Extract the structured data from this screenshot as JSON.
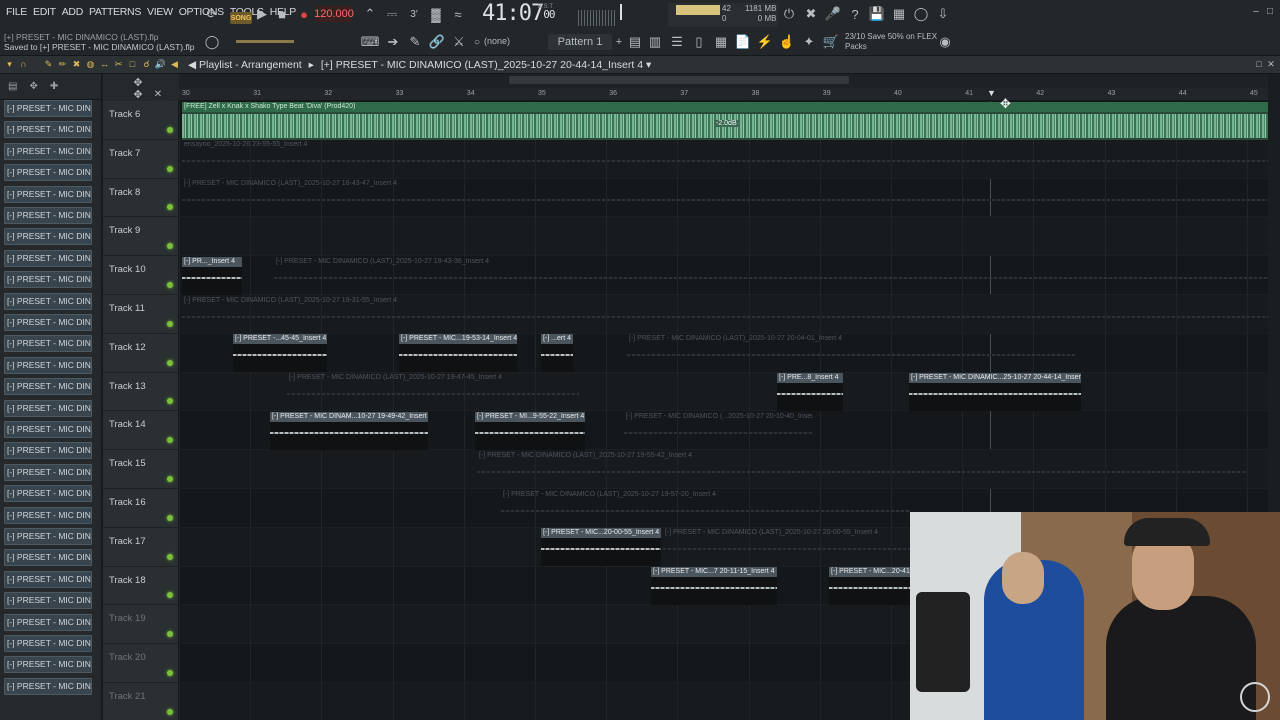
{
  "menu": [
    "FILE",
    "EDIT",
    "ADD",
    "PATTERNS",
    "VIEW",
    "OPTIONS",
    "TOOLS",
    "HELP"
  ],
  "file_status": {
    "project": "[+] PRESET - MIC DINAMICO (LAST).flp",
    "saved": "Saved to [+] PRESET - MIC DINAMICO (LAST).flp"
  },
  "transport": {
    "mode": "SONG",
    "tempo": "120.000",
    "time": "41:07",
    "time_sub": "00",
    "time_label": "B:S:T"
  },
  "meters": {
    "cpu": "42",
    "cpu_unit": "0",
    "mem": "1181 MB",
    "mem_sub": "0 MB"
  },
  "pattern": {
    "selector": "Pattern 1",
    "none": "(none)"
  },
  "promo": {
    "line1": "23/10",
    "line2": "Save 50% on FLEX",
    "line3": "Packs"
  },
  "playlist": {
    "title": "Playlist - Arrangement",
    "breadcrumb": "[+] PRESET - MIC DINAMICO (LAST)_2025-10-27 20-44-14_Insert 4"
  },
  "ruler_ticks": [
    "30",
    "31",
    "32",
    "33",
    "34",
    "35",
    "36",
    "37",
    "38",
    "39",
    "40",
    "41",
    "42",
    "43",
    "44",
    "45"
  ],
  "patterns": [
    "[-] PRESET - MIC DINAMIC..",
    "[-] PRESET - MIC DINAMIC..",
    "[-] PRESET - MIC DINAMIC..",
    "[-] PRESET - MIC DINAMIC..",
    "[-] PRESET - MIC DINAMIC..",
    "[-] PRESET - MIC DINAMIC..",
    "[-] PRESET - MIC DINAMIC..",
    "[-] PRESET - MIC DINAMIC..",
    "[-] PRESET - MIC DINAMIC..",
    "[-] PRESET - MIC DINAMIC..",
    "[-] PRESET - MIC DINAMIC..",
    "[-] PRESET - MIC DINAMIC..",
    "[-] PRESET - MIC DINAMIC..",
    "[-] PRESET - MIC DINAMIC..",
    "[-] PRESET - MIC DINAMIC..",
    "[-] PRESET - MIC DINAMIC..",
    "[-] PRESET - MIC DINAMIC..",
    "[-] PRESET - MIC DINAMIC..",
    "[-] PRESET - MIC DINAMIC..",
    "[-] PRESET - MIC DINAMIC..",
    "[-] PRESET - MIC DINAMIC..",
    "[-] PRESET - MIC DINAMIC..",
    "[-] PRESET - MIC DINAMIC..",
    "[-] PRESET - MIC DINAMIC..",
    "[-] PRESET - MIC DINAMIC..",
    "[-] PRESET - MIC DINAMIC..",
    "[-] PRESET - MIC DINAMIC..",
    "[-] PRESET - MIC DINAMIC.."
  ],
  "tracks": [
    "Track 6",
    "Track 7",
    "Track 8",
    "Track 9",
    "Track 10",
    "Track 11",
    "Track 12",
    "Track 13",
    "Track 14",
    "Track 15",
    "Track 16",
    "Track 17",
    "Track 18",
    "Track 19",
    "Track 20",
    "Track 21"
  ],
  "clips": {
    "t6": "[FREE] Zell x Knak x Shako Type Beat 'Diva' (Prod420)",
    "t6_gain": "-2.0dB",
    "t7": "ensayoo_2025-10-26 23-55-55_Insert 4",
    "t8": "[-] PRESET - MIC DINAMICO (LAST)_2025-10-27 16-43-47_Insert 4",
    "t10a": "[-] PR..._Insert 4",
    "t10b": "[-] PRESET - MIC DINAMICO (LAST)_2025-10-27 19-43-36_Insert 4",
    "t11": "[-] PRESET - MIC DINAMICO (LAST)_2025-10-27 19-31-55_Insert 4",
    "t12a": "[-] PRESET -...45-45_Insert 4",
    "t12b": "[-] PRESET - MIC...19-53-14_Insert 4",
    "t12c": "[-] ...ert 4",
    "t12d": "[-] PRESET - MIC DINAMICO (LAST)_2025-10-27 20-04-01_Insert 4",
    "t13a": "[-] PRESET - MIC DINAMICO (LAST)_2025-10-27 19-47-45_Insert 4",
    "t13b": "[-] PRE...8_Insert 4",
    "t13c": "[-] PRESET - MIC DINAMIC...25-10-27 20-44-14_Insert 4",
    "t14a": "[-] PRESET - MIC DINAM...10-27 19-49-42_Insert 4",
    "t14b": "[-] PRESET - MI...9-55-22_Insert 4",
    "t14c": "[-] PRESET - MIC DINAMICO (...2025-10-27 20-10-40_Insert 4",
    "t15": "[-] PRESET - MIC DINAMICO (LAST)_2025-10-27 19-55-42_Insert 4",
    "t16": "[-] PRESET - MIC DINAMICO (LAST)_2025-10-27 19-57-20_Insert 4",
    "t17a": "[-] PRESET - MIC...20-00-55_Insert 4",
    "t17b": "[-] PRESET - MIC DINAMICO (LAST)_2025-10-27 20-00-55_Insert 4",
    "t18a": "[-] PRESET - MIC...7 20-11-15_Insert 4",
    "t18b": "[-] PRESET - MIC...20-41"
  },
  "colors": {
    "accent": "#f4c55a",
    "audio_clip": "#2f6a4a",
    "led": "#7bbf3a"
  }
}
